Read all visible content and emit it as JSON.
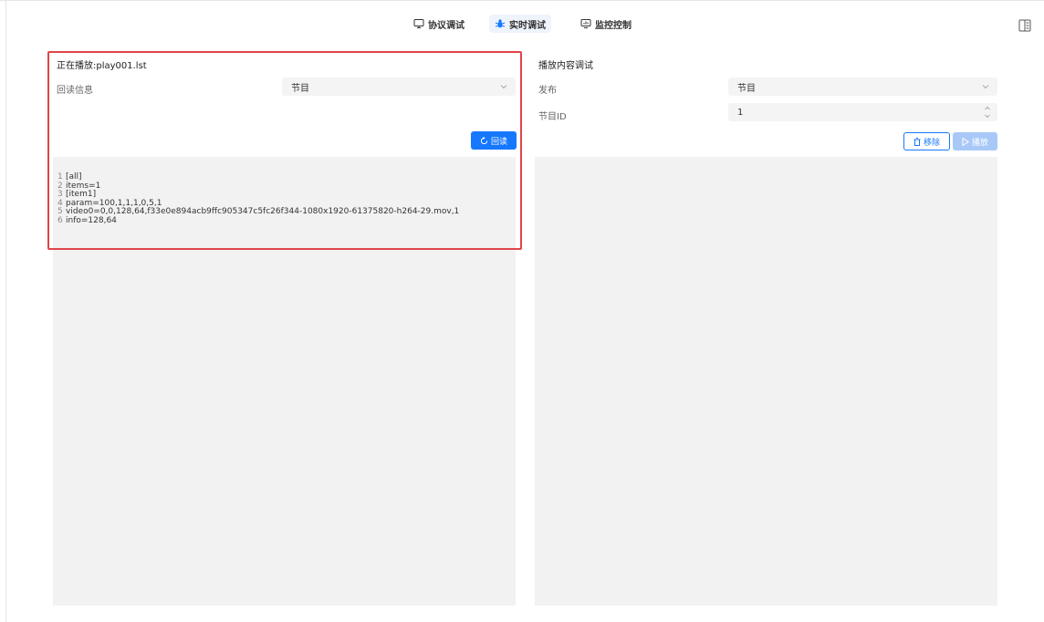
{
  "nav": {
    "tabs": [
      {
        "label": "协议调试",
        "icon": "monitor-icon",
        "active": false
      },
      {
        "label": "实时调试",
        "icon": "bug-icon",
        "active": true
      },
      {
        "label": "监控控制",
        "icon": "monitor-chart-icon",
        "active": false
      }
    ],
    "menu_icon": "sidebar-menu-icon"
  },
  "left": {
    "playing_label": "正在播放:play001.lst",
    "readback_label": "回读信息",
    "readback_select_value": "节目",
    "readback_button": "回读",
    "code_lines": [
      {
        "n": "1",
        "text": "[all]"
      },
      {
        "n": "2",
        "text": "items=1"
      },
      {
        "n": "3",
        "text": "[item1]"
      },
      {
        "n": "4",
        "text": "param=100,1,1,1,0,5,1"
      },
      {
        "n": "5",
        "text": "video0=0,0,128,64,f33e0e894acb9ffc905347c5fc26f344-1080x1920-61375820-h264-29.mov,1"
      },
      {
        "n": "6",
        "text": "info=128,64"
      }
    ]
  },
  "right": {
    "section_title": "播放内容调试",
    "publish_label": "发布",
    "publish_select_value": "节目",
    "program_id_label": "节目ID",
    "program_id_value": "1",
    "remove_button": "移除",
    "play_button": "播放"
  },
  "colors": {
    "accent": "#1677ff",
    "highlight_border": "#e0454a",
    "panel_bg": "#f2f2f2"
  }
}
